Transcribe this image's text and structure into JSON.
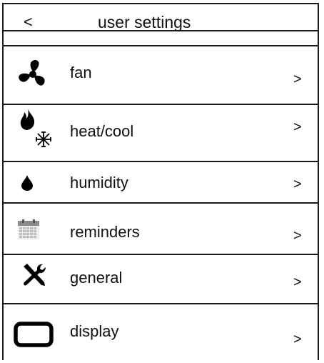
{
  "header": {
    "back_label": "<",
    "title": "user settings"
  },
  "menu": {
    "items": [
      {
        "id": "fan",
        "label": "fan",
        "chevron": ">",
        "icon": "fan-icon"
      },
      {
        "id": "heat-cool",
        "label": "heat/cool",
        "chevron": ">",
        "icon": "flame-snowflake-icon"
      },
      {
        "id": "humidity",
        "label": "humidity",
        "chevron": ">",
        "icon": "water-drop-icon"
      },
      {
        "id": "reminders",
        "label": "reminders",
        "chevron": ">",
        "icon": "calendar-icon"
      },
      {
        "id": "general",
        "label": "general",
        "chevron": ">",
        "icon": "wrench-screwdriver-icon"
      },
      {
        "id": "display",
        "label": "display",
        "chevron": ">",
        "icon": "display-icon"
      }
    ]
  },
  "colors": {
    "line": "#1a1a1a",
    "icon": "#000000",
    "calendar_top": "#8a8a8a",
    "calendar_grid": "#bdbdbd"
  }
}
